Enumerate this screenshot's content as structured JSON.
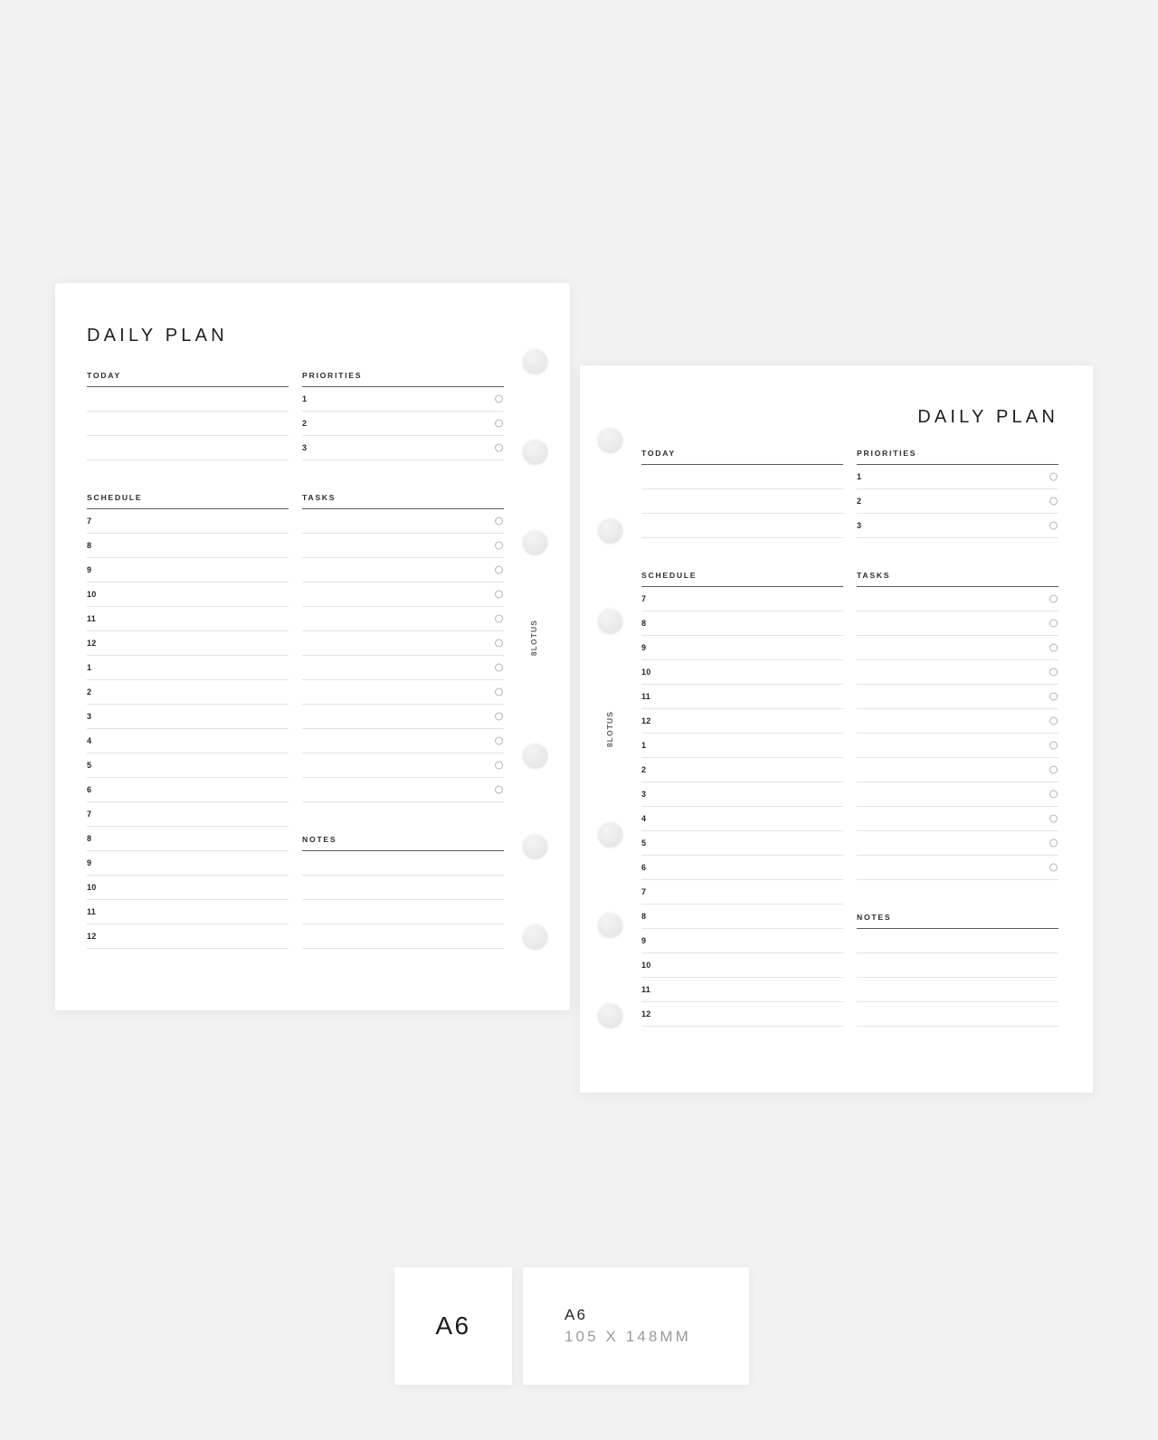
{
  "background_color": "#f2f2f2",
  "brand": "8LOTUS",
  "pages": [
    {
      "id": "left",
      "title": "DAILY PLAN",
      "title_align": "left",
      "holes_side": "right",
      "today": {
        "label": "TODAY",
        "lines": 3
      },
      "priorities": {
        "label": "PRIORITIES",
        "items": [
          "1",
          "2",
          "3"
        ]
      },
      "schedule": {
        "label": "SCHEDULE",
        "hours": [
          "7",
          "8",
          "9",
          "10",
          "11",
          "12",
          "1",
          "2",
          "3",
          "4",
          "5",
          "6",
          "7",
          "8",
          "9",
          "10",
          "11",
          "12"
        ]
      },
      "tasks": {
        "label": "TASKS",
        "rows": 12
      },
      "notes": {
        "label": "NOTES",
        "lines": 4
      }
    },
    {
      "id": "right",
      "title": "DAILY PLAN",
      "title_align": "right",
      "holes_side": "left",
      "today": {
        "label": "TODAY",
        "lines": 3
      },
      "priorities": {
        "label": "PRIORITIES",
        "items": [
          "1",
          "2",
          "3"
        ]
      },
      "schedule": {
        "label": "SCHEDULE",
        "hours": [
          "7",
          "8",
          "9",
          "10",
          "11",
          "12",
          "1",
          "2",
          "3",
          "4",
          "5",
          "6",
          "7",
          "8",
          "9",
          "10",
          "11",
          "12"
        ]
      },
      "tasks": {
        "label": "TASKS",
        "rows": 12
      },
      "notes": {
        "label": "NOTES",
        "lines": 4
      }
    }
  ],
  "size_badge": {
    "label": "A6"
  },
  "size_info": {
    "name": "A6",
    "dimensions": "105 X 148MM"
  }
}
